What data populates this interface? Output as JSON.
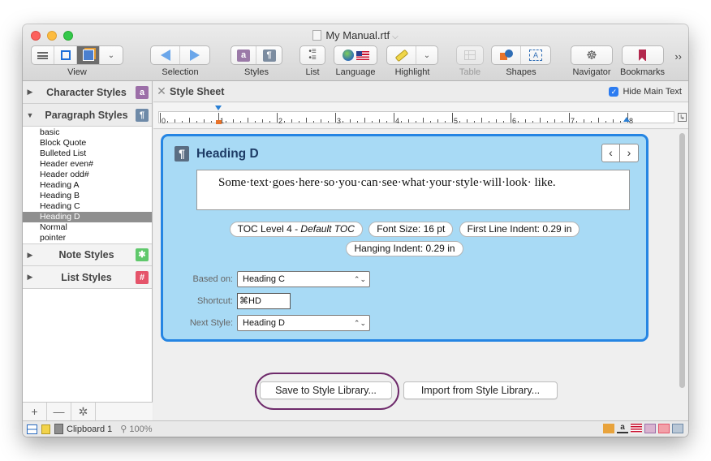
{
  "window": {
    "title": "My Manual.rtf"
  },
  "toolbar": {
    "groups": [
      {
        "label": "View"
      },
      {
        "label": "Selection"
      },
      {
        "label": "Styles"
      },
      {
        "label": "List"
      },
      {
        "label": "Language"
      },
      {
        "label": "Highlight"
      },
      {
        "label": "Table"
      },
      {
        "label": "Shapes"
      },
      {
        "label": "Navigator"
      },
      {
        "label": "Bookmarks"
      }
    ],
    "overflow": "››"
  },
  "sidebar": {
    "sections": {
      "character": {
        "title": "Character Styles",
        "badge": "a"
      },
      "paragraph": {
        "title": "Paragraph Styles",
        "badge": "¶"
      },
      "note": {
        "title": "Note Styles",
        "badge": "✱"
      },
      "list": {
        "title": "List Styles",
        "badge": "#"
      }
    },
    "paragraph_styles": [
      "basic",
      "Block Quote",
      "Bulleted List",
      "Header even#",
      "Header odd#",
      "Heading A",
      "Heading B",
      "Heading C",
      "Heading D",
      "Normal",
      "pointer"
    ],
    "selected_style": "Heading D",
    "footer": {
      "add": "+",
      "remove": "—",
      "gear": "✲"
    }
  },
  "style_sheet": {
    "title": "Style Sheet",
    "hide_main_text": {
      "label": "Hide Main Text",
      "checked": true
    },
    "ruler_numbers": [
      "0",
      "1",
      "2",
      "3",
      "4",
      "5",
      "6",
      "7",
      "8"
    ]
  },
  "style_card": {
    "name": "Heading D",
    "preview_text": "Some·text·goes·here·so·you·can·see·what·your·style·will·look· like.",
    "chips": {
      "toc_prefix": "TOC Level 4 - ",
      "toc_italic": "Default TOC",
      "font_size": "Font Size: 16 pt",
      "first_indent": "First Line Indent: 0.29 in",
      "hanging_indent": "Hanging Indent: 0.29 in"
    },
    "based_on": {
      "label": "Based on:",
      "value": "Heading C"
    },
    "shortcut": {
      "label": "Shortcut:",
      "value": "⌘HD"
    },
    "next_style": {
      "label": "Next Style:",
      "value": "Heading D"
    }
  },
  "buttons": {
    "save": "Save to Style Library...",
    "import": "Import from Style Library..."
  },
  "status": {
    "clipboard": "Clipboard 1",
    "zoom": "100%"
  },
  "colors": {
    "card_fill": "#a8daf5",
    "card_border": "#2585e3",
    "selection": "#8f8f8f",
    "highlight_ring": "#6e2a6b"
  }
}
